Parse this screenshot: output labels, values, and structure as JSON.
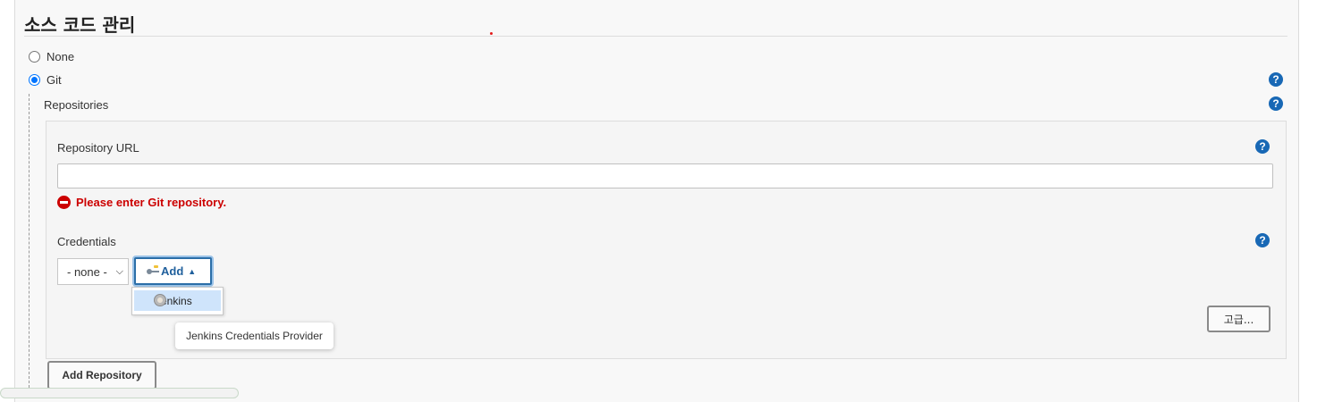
{
  "section": {
    "title": "소스 코드 관리"
  },
  "scm_options": [
    {
      "label": "None",
      "checked": false
    },
    {
      "label": "Git",
      "checked": true
    }
  ],
  "repositories": {
    "label": "Repositories",
    "repository_url": {
      "label": "Repository URL",
      "value": "",
      "placeholder": "",
      "error": "Please enter Git repository."
    },
    "credentials": {
      "label": "Credentials",
      "selected": "- none -",
      "add_label": "Add",
      "dropdown_items": [
        "Jenkins"
      ],
      "tooltip": "Jenkins Credentials Provider"
    },
    "advanced_label": "고급...",
    "add_repository_label": "Add Repository"
  },
  "help_icon": "?",
  "colors": {
    "help_blue": "#1868b5",
    "error_red": "#cc0000",
    "radio_blue": "#0075ff",
    "add_text": "#1f5f9c"
  },
  "icons": [
    "help-icon",
    "error-icon",
    "key-icon",
    "jenkins-icon",
    "chevron-down-icon",
    "caret-up-icon"
  ]
}
